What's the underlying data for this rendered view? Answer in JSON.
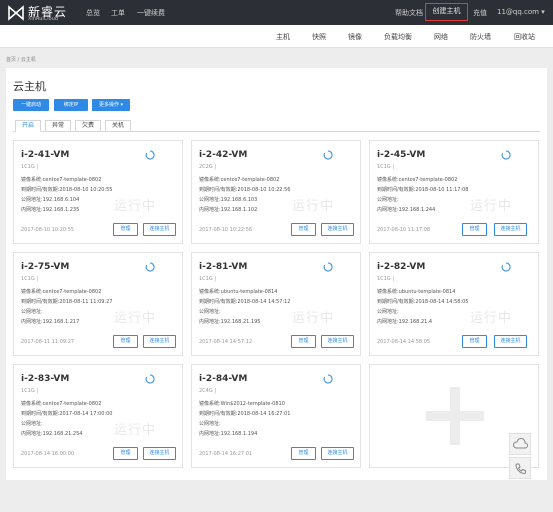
{
  "brand": {
    "name_cn": "新睿云",
    "name_en": "XinRuiCloud"
  },
  "topnav": [
    "总览",
    "工单",
    "一键续费"
  ],
  "topright": {
    "help": "帮助文档",
    "create": "创建主机",
    "recharge": "充值",
    "user": "11@qq.com ▾"
  },
  "subnav": [
    "主机",
    "快照",
    "镜像",
    "负载均衡",
    "网络",
    "防火墙",
    "回收站"
  ],
  "breadcrumb": "首页 / 云主机",
  "page_title": "云主机",
  "buttons": {
    "oneclick": "一键启动",
    "bind_ip": "绑定IP",
    "more": "更多操作 ▾"
  },
  "tabs": [
    "开启",
    "异常",
    "欠费",
    "关机"
  ],
  "card_labels": {
    "manage": "管理",
    "connect": "连接主机",
    "watermark": "运行中"
  },
  "cards": [
    {
      "name": "i-2-41-VM",
      "spec": "1C1G |",
      "os": "镜像系统:centos7-template-0802",
      "expire": "到期时间/有效期:2018-08-10 10:20:55",
      "public_ip": "公网地址:192.168.6.104",
      "private_ip": "内网地址:192.168.1.235",
      "date": "2017-08-10 10:20:55"
    },
    {
      "name": "i-2-42-VM",
      "spec": "2C2G |",
      "os": "镜像系统:centos7-template-0802",
      "expire": "到期时间/有效期:2018-08-10 10:22:56",
      "public_ip": "公网地址:192.168.6.103",
      "private_ip": "内网地址:192.168.1.102",
      "date": "2017-08-10 10:22:56"
    },
    {
      "name": "i-2-45-VM",
      "spec": "1C1G |",
      "os": "镜像系统:centos7-template-0802",
      "expire": "到期时间/有效期:2018-08-10 11:17:08",
      "public_ip": "公网地址:",
      "private_ip": "内网地址:192.168.1.244",
      "date": "2017-08-10 11:17:08"
    },
    {
      "name": "i-2-75-VM",
      "spec": "1C1G |",
      "os": "镜像系统:centos7-template-0802",
      "expire": "到期时间/有效期:2018-08-11 11:09:27",
      "public_ip": "公网地址:",
      "private_ip": "内网地址:192.168.1.217",
      "date": "2017-08-11 11:09:27"
    },
    {
      "name": "i-2-81-VM",
      "spec": "1C1G |",
      "os": "镜像系统:ubuntu-template-0814",
      "expire": "到期时间/有效期:2018-08-14 14:57:12",
      "public_ip": "公网地址:",
      "private_ip": "内网地址:192.168.21.195",
      "date": "2017-08-14 14:57:12"
    },
    {
      "name": "i-2-82-VM",
      "spec": "1C1G |",
      "os": "镜像系统:ubuntu-template-0814",
      "expire": "到期时间/有效期:2018-08-14 14:58:05",
      "public_ip": "公网地址:",
      "private_ip": "内网地址:192.168.21.4",
      "date": "2017-08-14 14:58:05"
    },
    {
      "name": "i-2-83-VM",
      "spec": "1C1G |",
      "os": "镜像系统:centos7-template-0802",
      "expire": "到期时间/有效期:2017-08-14 17:00:00",
      "public_ip": "公网地址:",
      "private_ip": "内网地址:192.168.21.254",
      "date": "2017-08-14 16:00:00"
    },
    {
      "name": "i-2-84-VM",
      "spec": "2C4G |",
      "os": "镜像系统:Win$2012-template-0810",
      "expire": "到期时间/有效期:2018-08-14 16:27:01",
      "public_ip": "公网地址:",
      "private_ip": "内网地址:192.168.1.194",
      "date": "2017-08-14 16:27:01"
    }
  ],
  "colors": {
    "topbar": "#2c2f35",
    "primary": "#2f8ae5",
    "highlight": "#e23b3b"
  },
  "icons": {
    "spinner": "loading-spinner-icon",
    "add": "plus-icon",
    "float1": "cloud-service-icon",
    "float2": "phone-icon"
  }
}
